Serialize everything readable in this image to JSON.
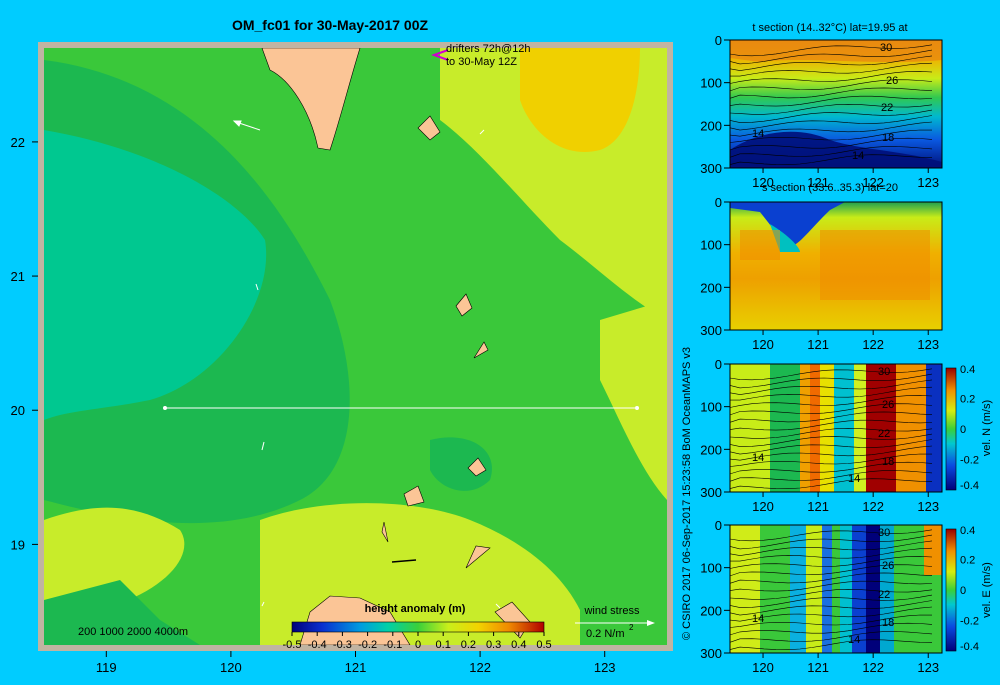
{
  "title": "OM_fc01 for 30-May-2017 00Z",
  "credit": "© CSIRO 2017   06-Sep-2017 15:23:58 BoM OceanMAPS v3",
  "colors": {
    "background": "#00ccff",
    "land": "#fbc596",
    "frame": "#c0b4a2"
  },
  "main_map": {
    "drifter_note_line1": "drifters 72h@12h",
    "drifter_note_line2": "to 30-May 12Z",
    "bathymetry_legend": "200  1000  2000  4000m",
    "colorbar_title": "height anomaly  (m)",
    "wind_stress_title": "wind stress",
    "wind_stress_unit": "0.2 N/m",
    "wind_stress_exp": "2"
  },
  "chart_data": [
    {
      "type": "heatmap",
      "name": "main_map",
      "title": "OM_fc01 for 30-May-2017 00Z",
      "x_ticks": [
        119,
        120,
        121,
        122,
        123
      ],
      "y_ticks": [
        19,
        20,
        21,
        22
      ],
      "xlim": [
        118.5,
        123.5
      ],
      "ylim": [
        18.25,
        22.7
      ],
      "variable": "height anomaly (m)",
      "colorbar_ticks": [
        -0.5,
        -0.4,
        -0.3,
        -0.2,
        -0.1,
        0,
        0.1,
        0.2,
        0.3,
        0.4,
        0.5
      ],
      "section_line": {
        "lat": 20,
        "lon_start": 119.5,
        "lon_end": 123.2
      }
    },
    {
      "type": "heatmap",
      "name": "t_section",
      "title": "t section (14..32°C) lat=19.95 at",
      "x_ticks": [
        120,
        121,
        122,
        123
      ],
      "y_ticks": [
        0,
        100,
        200,
        300
      ],
      "contour_labels": [
        "30",
        "26",
        "22",
        "18",
        "14",
        "14"
      ]
    },
    {
      "type": "heatmap",
      "name": "s_section",
      "title": "s section (33.6..35.3) lat=20",
      "x_ticks": [
        120,
        121,
        122,
        123
      ],
      "y_ticks": [
        0,
        100,
        200,
        300
      ]
    },
    {
      "type": "heatmap",
      "name": "v_section",
      "x_ticks": [
        120,
        121,
        122,
        123
      ],
      "y_ticks": [
        0,
        100,
        200,
        300
      ],
      "colorbar_label": "vel. N (m/s)",
      "colorbar_ticks": [
        0.4,
        0.2,
        0,
        -0.2,
        -0.4
      ],
      "contour_labels": [
        "30",
        "26",
        "22",
        "18",
        "14",
        "14"
      ]
    },
    {
      "type": "heatmap",
      "name": "u_section",
      "x_ticks": [
        120,
        121,
        122,
        123
      ],
      "y_ticks": [
        0,
        100,
        200,
        300
      ],
      "colorbar_label": "vel. E (m/s)",
      "colorbar_ticks": [
        0.4,
        0.2,
        0,
        -0.2,
        -0.4
      ],
      "contour_labels": [
        "30",
        "26",
        "22",
        "18",
        "14",
        "14"
      ]
    }
  ]
}
